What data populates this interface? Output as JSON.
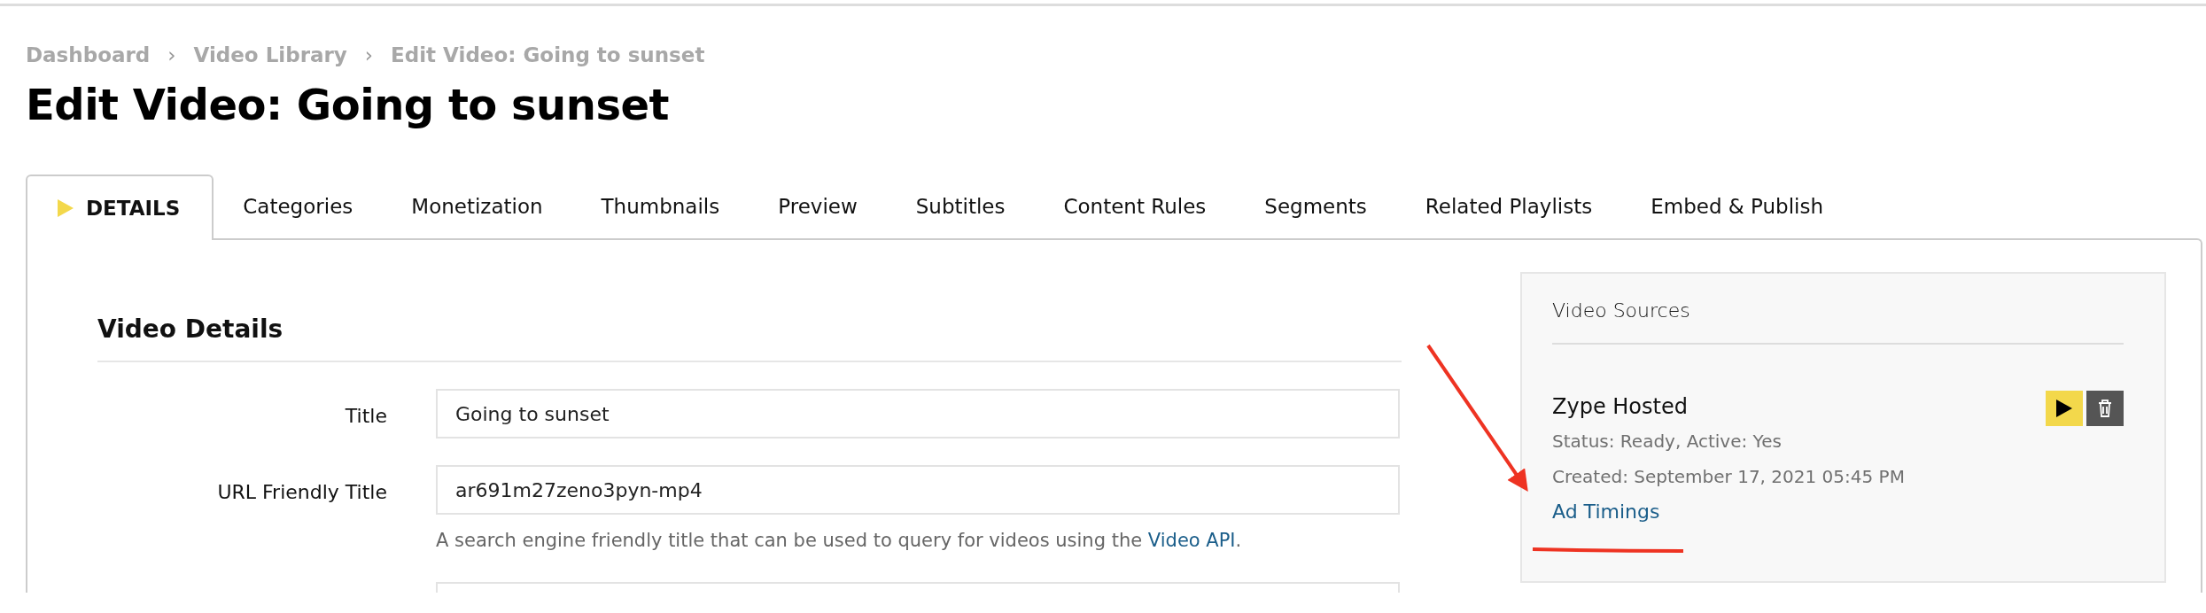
{
  "breadcrumb": {
    "items": [
      {
        "label": "Dashboard"
      },
      {
        "label": "Video Library"
      },
      {
        "label": "Edit Video: Going to sunset"
      }
    ],
    "separators": [
      "›",
      "›"
    ]
  },
  "page_title": "Edit Video: Going to sunset",
  "tabs": [
    {
      "label": "DETAILS",
      "selected": true
    },
    {
      "label": "Categories",
      "selected": false
    },
    {
      "label": "Monetization",
      "selected": false
    },
    {
      "label": "Thumbnails",
      "selected": false
    },
    {
      "label": "Preview",
      "selected": false
    },
    {
      "label": "Subtitles",
      "selected": false
    },
    {
      "label": "Content Rules",
      "selected": false
    },
    {
      "label": "Segments",
      "selected": false
    },
    {
      "label": "Related Playlists",
      "selected": false
    },
    {
      "label": "Embed & Publish",
      "selected": false
    }
  ],
  "video_details": {
    "heading": "Video Details",
    "fields": [
      {
        "kind": "text",
        "label": "Title",
        "value": "Going to sunset"
      },
      {
        "kind": "text",
        "label": "URL Friendly Title",
        "value": "ar691m27zeno3pyn-mp4",
        "help_text": "A search engine friendly title that can be used to query for videos using the ",
        "help_link": "Video API",
        "help_suffix": "."
      },
      {
        "kind": "cut_off"
      }
    ]
  },
  "video_sources": {
    "heading": "Video Sources",
    "sources": [
      {
        "name": "Zype Hosted",
        "status": "Status: Ready, Active: Yes",
        "created": "Created: September 17, 2021 05:45 PM",
        "link": "Ad Timings"
      }
    ]
  },
  "annotations": {
    "arrow": true,
    "underline": true
  }
}
